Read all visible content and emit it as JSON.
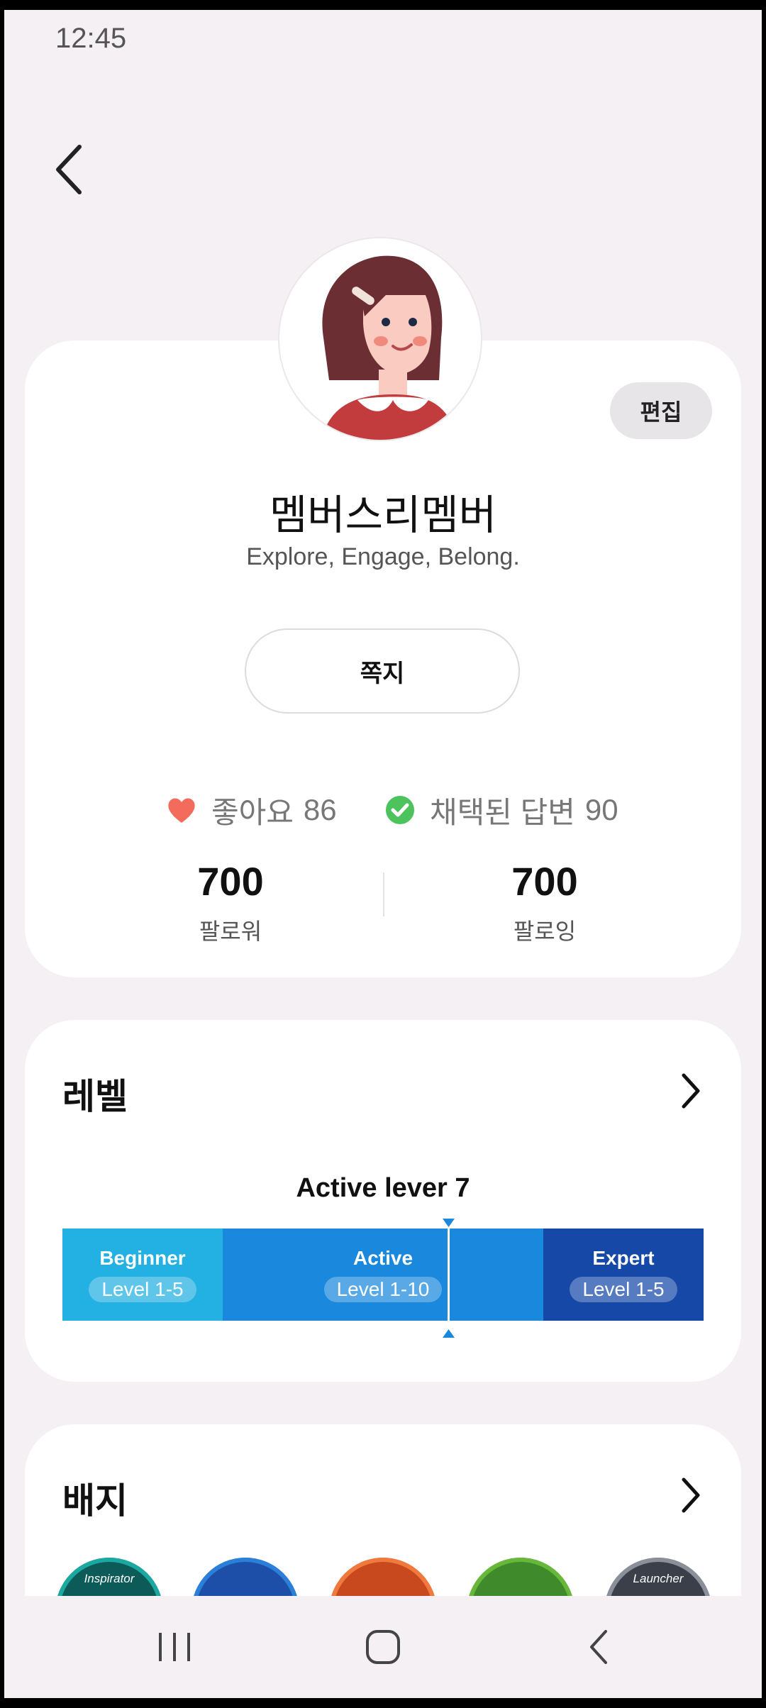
{
  "status_bar": {
    "time": "12:45"
  },
  "profile": {
    "edit_label": "편집",
    "nickname": "멤버스리멤버",
    "tagline": "Explore, Engage, Belong.",
    "message_label": "쪽지",
    "likes_label": "좋아요",
    "likes_count": "86",
    "accepted_label": "채택된 답변",
    "accepted_count": "90",
    "followers_count": "700",
    "followers_label": "팔로워",
    "following_count": "700",
    "following_label": "팔로잉"
  },
  "level": {
    "title": "레벨",
    "caption": "Active lever 7",
    "segments": [
      {
        "name": "Beginner",
        "range": "Level 1-5",
        "color": "#22b1e2"
      },
      {
        "name": "Active",
        "range": "Level 1-10",
        "color": "#1a88dd"
      },
      {
        "name": "Expert",
        "range": "Level 1-5",
        "color": "#1648a8"
      }
    ],
    "current_progress": 0.6
  },
  "badges": {
    "title": "배지",
    "items": [
      {
        "label": "Inspirator",
        "icon": "inspirator-badge-icon"
      },
      {
        "label": "",
        "icon": "space-badge-icon"
      },
      {
        "label": "",
        "icon": "planet-badge-icon"
      },
      {
        "label": "",
        "icon": "forest-badge-icon"
      },
      {
        "label": "Launcher",
        "icon": "launcher-badge-icon"
      }
    ]
  },
  "colors": {
    "heart": "#f26b5b",
    "check": "#4cc35c",
    "background": "#f4f0f3"
  }
}
